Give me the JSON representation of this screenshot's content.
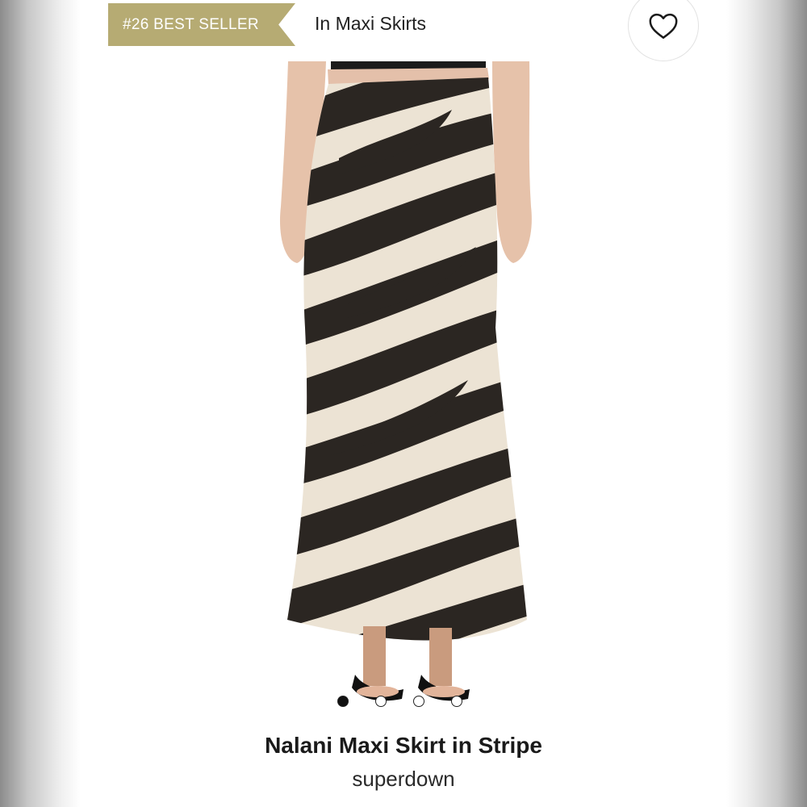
{
  "badge": {
    "text": "#26 BEST SELLER"
  },
  "category": {
    "text": "In Maxi Skirts"
  },
  "favorite": {
    "icon": "heart-icon"
  },
  "product": {
    "title": "Nalani Maxi Skirt in Stripe",
    "brand": "superdown",
    "image": {
      "subject": "zebra-print-maxi-skirt"
    }
  },
  "carousel": {
    "count": 4,
    "active": 1
  },
  "colors": {
    "badge": "#b6ab73",
    "print_dark": "#2b2622",
    "print_light": "#ece3d4"
  }
}
